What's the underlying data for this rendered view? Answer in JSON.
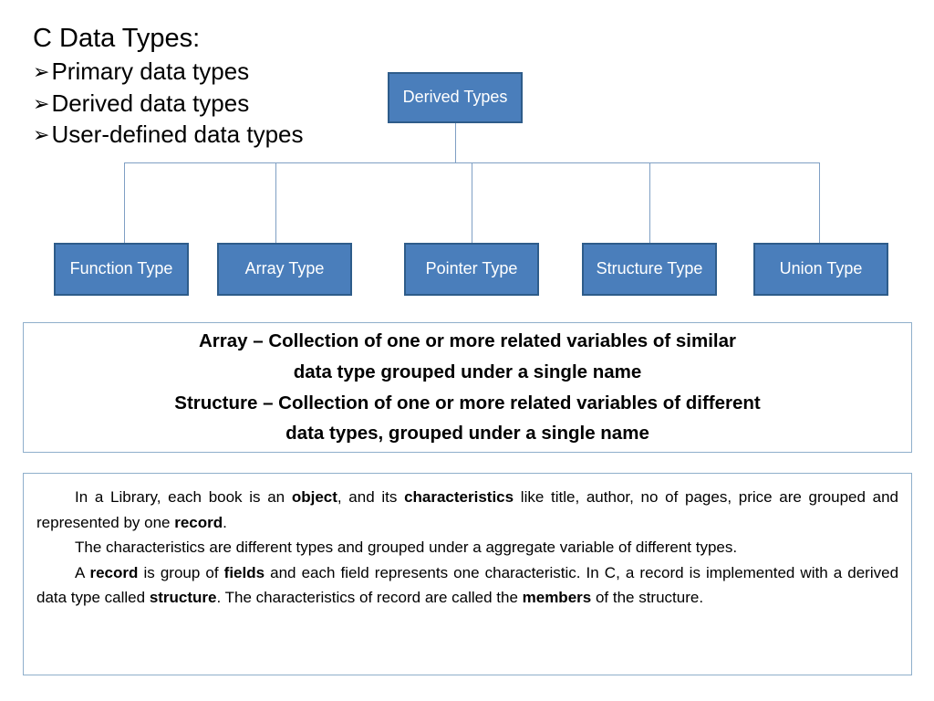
{
  "heading": {
    "title": "C Data Types:",
    "bullet_glyph": "➢",
    "bullets": [
      "Primary data types",
      "Derived data types",
      "User-defined data types"
    ]
  },
  "chart_data": {
    "type": "diagram",
    "layout": "org-chart",
    "title": "Derived Types hierarchy",
    "colors": {
      "node_fill": "#4a7ebb",
      "node_border": "#2e5c8a",
      "node_text": "#ffffff",
      "connector": "#7f9fc4",
      "panel_border": "#8fafcb"
    },
    "root": {
      "label": "Derived Types"
    },
    "children": [
      {
        "label": "Function Type"
      },
      {
        "label": "Array Type"
      },
      {
        "label": "Pointer Type"
      },
      {
        "label": "Structure Type"
      },
      {
        "label": "Union Type"
      }
    ]
  },
  "definition": {
    "lines": [
      "Array – Collection of one or more related variables of similar",
      "data type grouped under a single name",
      "Structure – Collection of one or more related variables of different",
      "data types, grouped under a single name"
    ]
  },
  "narrative": {
    "paragraphs": [
      {
        "segments": [
          {
            "text": "In a Library, each book is an ",
            "bold": false
          },
          {
            "text": "object",
            "bold": true
          },
          {
            "text": ", and its ",
            "bold": false
          },
          {
            "text": "characteristics",
            "bold": true
          },
          {
            "text": " like title, author, no of pages, price are grouped and represented by one ",
            "bold": false
          },
          {
            "text": "record",
            "bold": true
          },
          {
            "text": ".",
            "bold": false
          }
        ]
      },
      {
        "segments": [
          {
            "text": "The characteristics are different types and grouped under a aggregate variable of different types.",
            "bold": false
          }
        ]
      },
      {
        "segments": [
          {
            "text": "A ",
            "bold": false
          },
          {
            "text": "record",
            "bold": true
          },
          {
            "text": " is group of ",
            "bold": false
          },
          {
            "text": "fields",
            "bold": true
          },
          {
            "text": " and each field represents one characteristic.  In C, a record is implemented with a derived data type called ",
            "bold": false
          },
          {
            "text": "structure",
            "bold": true
          },
          {
            "text": ". The characteristics of record are called the ",
            "bold": false
          },
          {
            "text": "members",
            "bold": true
          },
          {
            "text": " of the structure.",
            "bold": false
          }
        ]
      }
    ]
  }
}
